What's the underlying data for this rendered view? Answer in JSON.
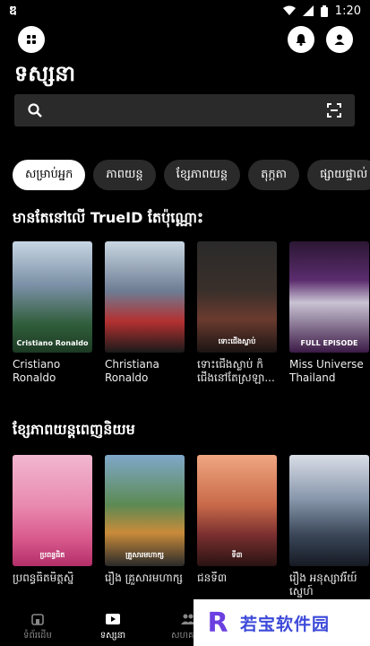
{
  "status": {
    "time": "1:20",
    "logo": "ឌ"
  },
  "header": {
    "title": "ទស្សនា",
    "menu_icon": "grid-icon",
    "bell_icon": "bell-icon",
    "user_icon": "user-icon"
  },
  "search": {
    "placeholder": "",
    "value": ""
  },
  "chips": [
    "សម្រាប់អ្នក",
    "ភាពយន្ត",
    "ខ្សែភាពយន្ត",
    "តុក្កតា",
    "ផ្សាយផ្ទាល់"
  ],
  "section1": {
    "title": "មានតែនៅលើ TrueID តែប៉ុណ្ណោះ",
    "items": [
      {
        "title": "Cristiano Ronaldo",
        "poster_text": "Cristiano Ronaldo"
      },
      {
        "title": "Christiana Ronaldo",
        "poster_text": ""
      },
      {
        "title": "ទោះជើងស្លាប់ ក៏ជើងនៅតែស្រឡា...",
        "poster_text": "ទោះជើងស្លាប់"
      },
      {
        "title": "Miss Universe Thailand 202...",
        "poster_text": "FULL EPISODE"
      }
    ]
  },
  "section2": {
    "title": "ខ្សែភាពយន្តពេញនិយម",
    "items": [
      {
        "title": "ប្រពន្ធធិតមិត្តស្និ",
        "poster_text": "ប្រពន្ធធិត"
      },
      {
        "title": "រឿង គ្រួសារមហាក្ស",
        "poster_text": "គ្រួសារមហាក្ស"
      },
      {
        "title": "ជនទី៣",
        "poster_text": "ទី៣"
      },
      {
        "title": "រឿង អនុស្សាវរីយ៍ស្នេហ៍",
        "poster_text": ""
      }
    ]
  },
  "nav": [
    {
      "label": "ទំព័រដើម",
      "icon": "home-icon"
    },
    {
      "label": "ទស្សនា",
      "icon": "play-icon"
    },
    {
      "label": "សហគមន៍",
      "icon": "people-icon"
    }
  ],
  "watermark": {
    "text": "若宝软件园",
    "logo": "R"
  }
}
